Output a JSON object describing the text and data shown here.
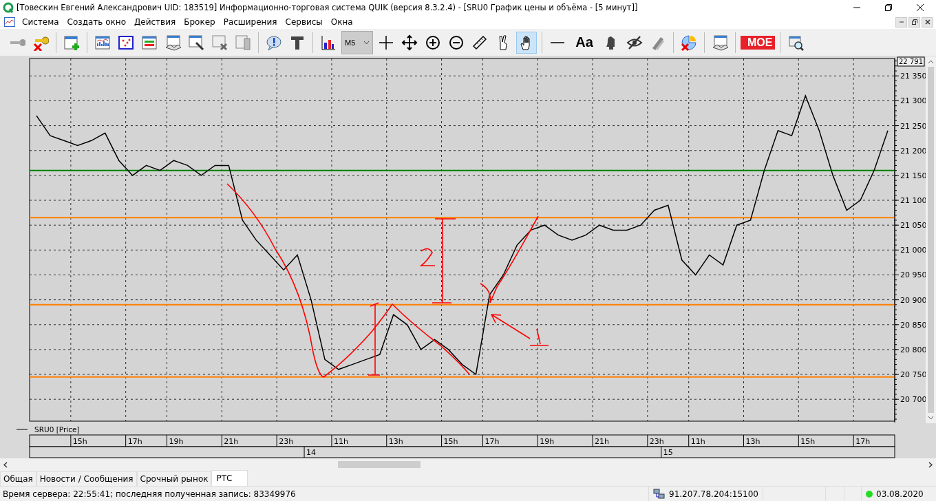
{
  "window": {
    "title": "[Товескин Евгений Александрович UID: 183519] Информационно-торговая система QUIK (версия 8.3.2.4) - [SRU0 График цены и объёма - [5 минут]]"
  },
  "menu": [
    "Система",
    "Создать окно",
    "Действия",
    "Брокер",
    "Расширения",
    "Сервисы",
    "Окна"
  ],
  "toolbar": [
    {
      "kind": "key"
    },
    {
      "kind": "key-x"
    },
    {
      "kind": "separator"
    },
    {
      "kind": "new-window"
    },
    {
      "kind": "separator"
    },
    {
      "kind": "chart"
    },
    {
      "kind": "scatter"
    },
    {
      "kind": "stripes"
    },
    {
      "kind": "handshake"
    },
    {
      "kind": "wrench"
    },
    {
      "kind": "table-x"
    },
    {
      "kind": "table-copy"
    },
    {
      "kind": "separator"
    },
    {
      "kind": "alert"
    },
    {
      "kind": "text"
    },
    {
      "kind": "separator"
    },
    {
      "kind": "bars"
    },
    {
      "kind": "timeframe",
      "label": "M5"
    },
    {
      "kind": "cross",
      "selected": false
    },
    {
      "kind": "move",
      "selected": false
    },
    {
      "kind": "zoom-in",
      "selected": false
    },
    {
      "kind": "zoom-out",
      "selected": false
    },
    {
      "kind": "ruler",
      "selected": false
    },
    {
      "kind": "fingers",
      "selected": false
    },
    {
      "kind": "hand",
      "selected": true
    },
    {
      "kind": "separator"
    },
    {
      "kind": "line"
    },
    {
      "kind": "font",
      "label": "Aa"
    },
    {
      "kind": "bell"
    },
    {
      "kind": "eye"
    },
    {
      "kind": "pencil"
    },
    {
      "kind": "separator"
    },
    {
      "kind": "pie-x"
    },
    {
      "kind": "separator"
    },
    {
      "kind": "handshake"
    },
    {
      "kind": "separator"
    },
    {
      "kind": "moex",
      "label": "MOE"
    },
    {
      "kind": "separator"
    },
    {
      "kind": "preview"
    }
  ],
  "chart": {
    "price_box": "22 791",
    "chart_data": {
      "type": "line",
      "ylim": [
        20656,
        21385
      ],
      "categories": [
        null,
        null,
        null,
        "15h",
        null,
        null,
        null,
        "17h",
        null,
        null,
        "19h",
        null,
        null,
        null,
        "21h",
        null,
        null,
        null,
        "23h",
        null,
        null,
        null,
        "11h",
        null,
        null,
        null,
        "13h",
        null,
        null,
        null,
        "15h",
        null,
        null,
        "17h",
        null,
        null,
        null,
        "19h",
        null,
        null,
        null,
        "21h",
        null,
        null,
        null,
        "23h",
        null,
        null,
        "11h",
        null,
        null,
        null,
        "13h",
        null,
        null,
        null,
        "15h",
        null,
        null,
        null,
        "17h",
        null,
        null
      ],
      "series": [
        {
          "name": "SRU0 [Price]",
          "color": "#000000",
          "values": [
            21270,
            21230,
            21220,
            21210,
            21220,
            21235,
            21180,
            21150,
            21170,
            21160,
            21180,
            21170,
            21150,
            21170,
            21170,
            21060,
            21020,
            20990,
            20960,
            20990,
            20900,
            20780,
            20760,
            20770,
            20780,
            20790,
            20870,
            20850,
            20800,
            20820,
            20800,
            20770,
            20750,
            20910,
            20950,
            21010,
            21040,
            21050,
            21030,
            21020,
            21030,
            21050,
            21040,
            21040,
            21050,
            21080,
            21090,
            20980,
            20950,
            20990,
            20970,
            21050,
            21060,
            21160,
            21240,
            21230,
            21310,
            21240,
            21150,
            21080,
            21100,
            21160,
            21240
          ]
        }
      ],
      "yticks": [
        {
          "value": 20700,
          "label": "20 700"
        },
        {
          "value": 20750,
          "label": "20 750"
        },
        {
          "value": 20800,
          "label": "20 800"
        },
        {
          "value": 20850,
          "label": "20 850"
        },
        {
          "value": 20900,
          "label": "20 900"
        },
        {
          "value": 20950,
          "label": "20 950"
        },
        {
          "value": 21000,
          "label": "21 000"
        },
        {
          "value": 21050,
          "label": "21 050"
        },
        {
          "value": 21100,
          "label": "21 100"
        },
        {
          "value": 21150,
          "label": "21 150"
        },
        {
          "value": 21200,
          "label": "21 200"
        },
        {
          "value": 21250,
          "label": "21 250"
        },
        {
          "value": 21300,
          "label": "21 300"
        },
        {
          "value": 21350,
          "label": "21 350"
        }
      ],
      "grid": true,
      "ref_lines": [
        {
          "axis": "y",
          "value": 21160,
          "color": "#008000"
        },
        {
          "axis": "y",
          "value": 21065,
          "color": "#ff8000"
        },
        {
          "axis": "y",
          "value": 20890,
          "color": "#ff8000"
        },
        {
          "axis": "y",
          "value": 20745,
          "color": "#ff8000"
        }
      ]
    },
    "date_row": [
      {
        "label": "14"
      },
      {
        "label": "15"
      }
    ]
  },
  "tabs": [
    {
      "label": "Общая",
      "selected": false
    },
    {
      "label": "Новости / Сообщения",
      "selected": false
    },
    {
      "label": "Срочный рынок",
      "selected": false
    },
    {
      "label": "РТС",
      "selected": true
    }
  ],
  "status_bar": {
    "text": "Время сервера: 22:55:41; последняя полученная запись: 83349976",
    "server": "91.207.78.204:15100",
    "connected": true,
    "date": "03.08.2020"
  }
}
